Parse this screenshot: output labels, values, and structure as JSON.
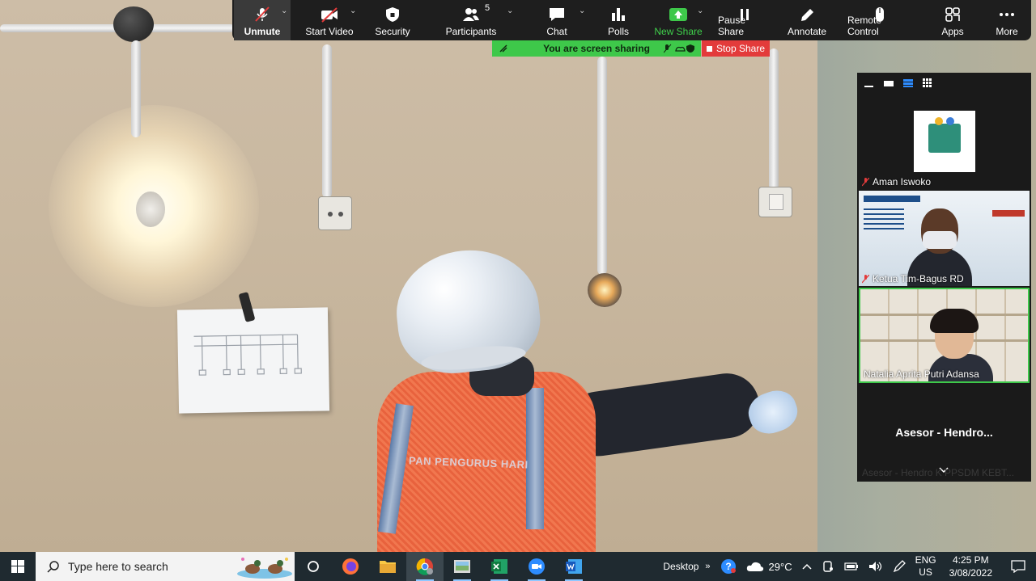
{
  "toolbar": {
    "unmute_label": "Unmute",
    "start_video_label": "Start Video",
    "security_label": "Security",
    "participants_label": "Participants",
    "participants_count": "5",
    "chat_label": "Chat",
    "polls_label": "Polls",
    "new_share_label": "New Share",
    "pause_share_label": "Pause Share",
    "annotate_label": "Annotate",
    "remote_control_label": "Remote Control",
    "apps_label": "Apps",
    "more_label": "More"
  },
  "share_banner": {
    "text": "You are screen sharing",
    "stop_label": "Stop Share"
  },
  "participants": [
    {
      "name": "Aman Iswoko",
      "muted": true
    },
    {
      "name": "Ketua Tim-Bagus RD",
      "muted": true
    },
    {
      "name": "Natalia Aprita Putri Adansa",
      "muted": false
    },
    {
      "name": "Asesor - Hendro...",
      "muted": false
    },
    {
      "name": "Asesor - Hendro K PPSDM KEBT...",
      "muted": true
    }
  ],
  "scene": {
    "vest_text": "PAN PENGURUS HARI"
  },
  "taskbar": {
    "search_placeholder": "Type here to search",
    "desktop_label": "Desktop",
    "weather": "29°C",
    "lang_top": "ENG",
    "lang_bottom": "US",
    "time": "4:25 PM",
    "date": "3/08/2022"
  },
  "colors": {
    "toolbar_bg": "#1e1e1e",
    "share_green": "#3ec84a",
    "stop_red": "#e33b3b",
    "taskbar_bg": "#1f2a30"
  }
}
